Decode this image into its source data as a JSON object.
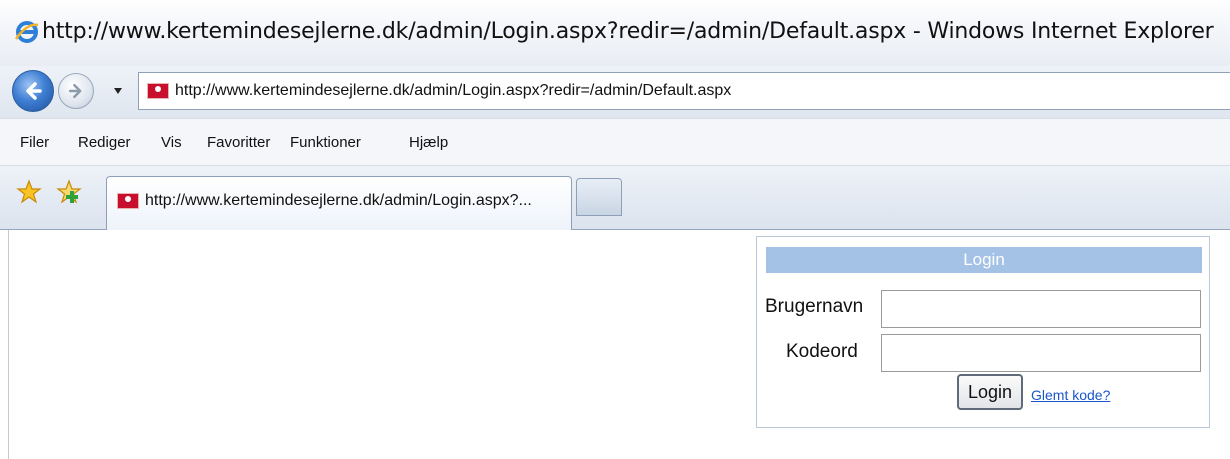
{
  "window": {
    "title": "http://www.kertemindesejlerne.dk/admin/Login.aspx?redir=/admin/Default.aspx - Windows Internet Explorer"
  },
  "toolbar": {
    "address": "http://www.kertemindesejlerne.dk/admin/Login.aspx?redir=/admin/Default.aspx"
  },
  "menu": {
    "items": [
      "Filer",
      "Rediger",
      "Vis",
      "Favoritter",
      "Funktioner",
      "Hjælp"
    ]
  },
  "tabs": {
    "active_label": "http://www.kertemindesejlerne.dk/admin/Login.aspx?..."
  },
  "login": {
    "header": "Login",
    "username_label": "Brugernavn",
    "username_value": "",
    "password_label": "Kodeord",
    "password_value": "",
    "submit_label": "Login",
    "forgot_label": "Glemt kode?"
  },
  "colors": {
    "login_header_bg": "#a4c1e6",
    "link": "#1a56c9"
  }
}
